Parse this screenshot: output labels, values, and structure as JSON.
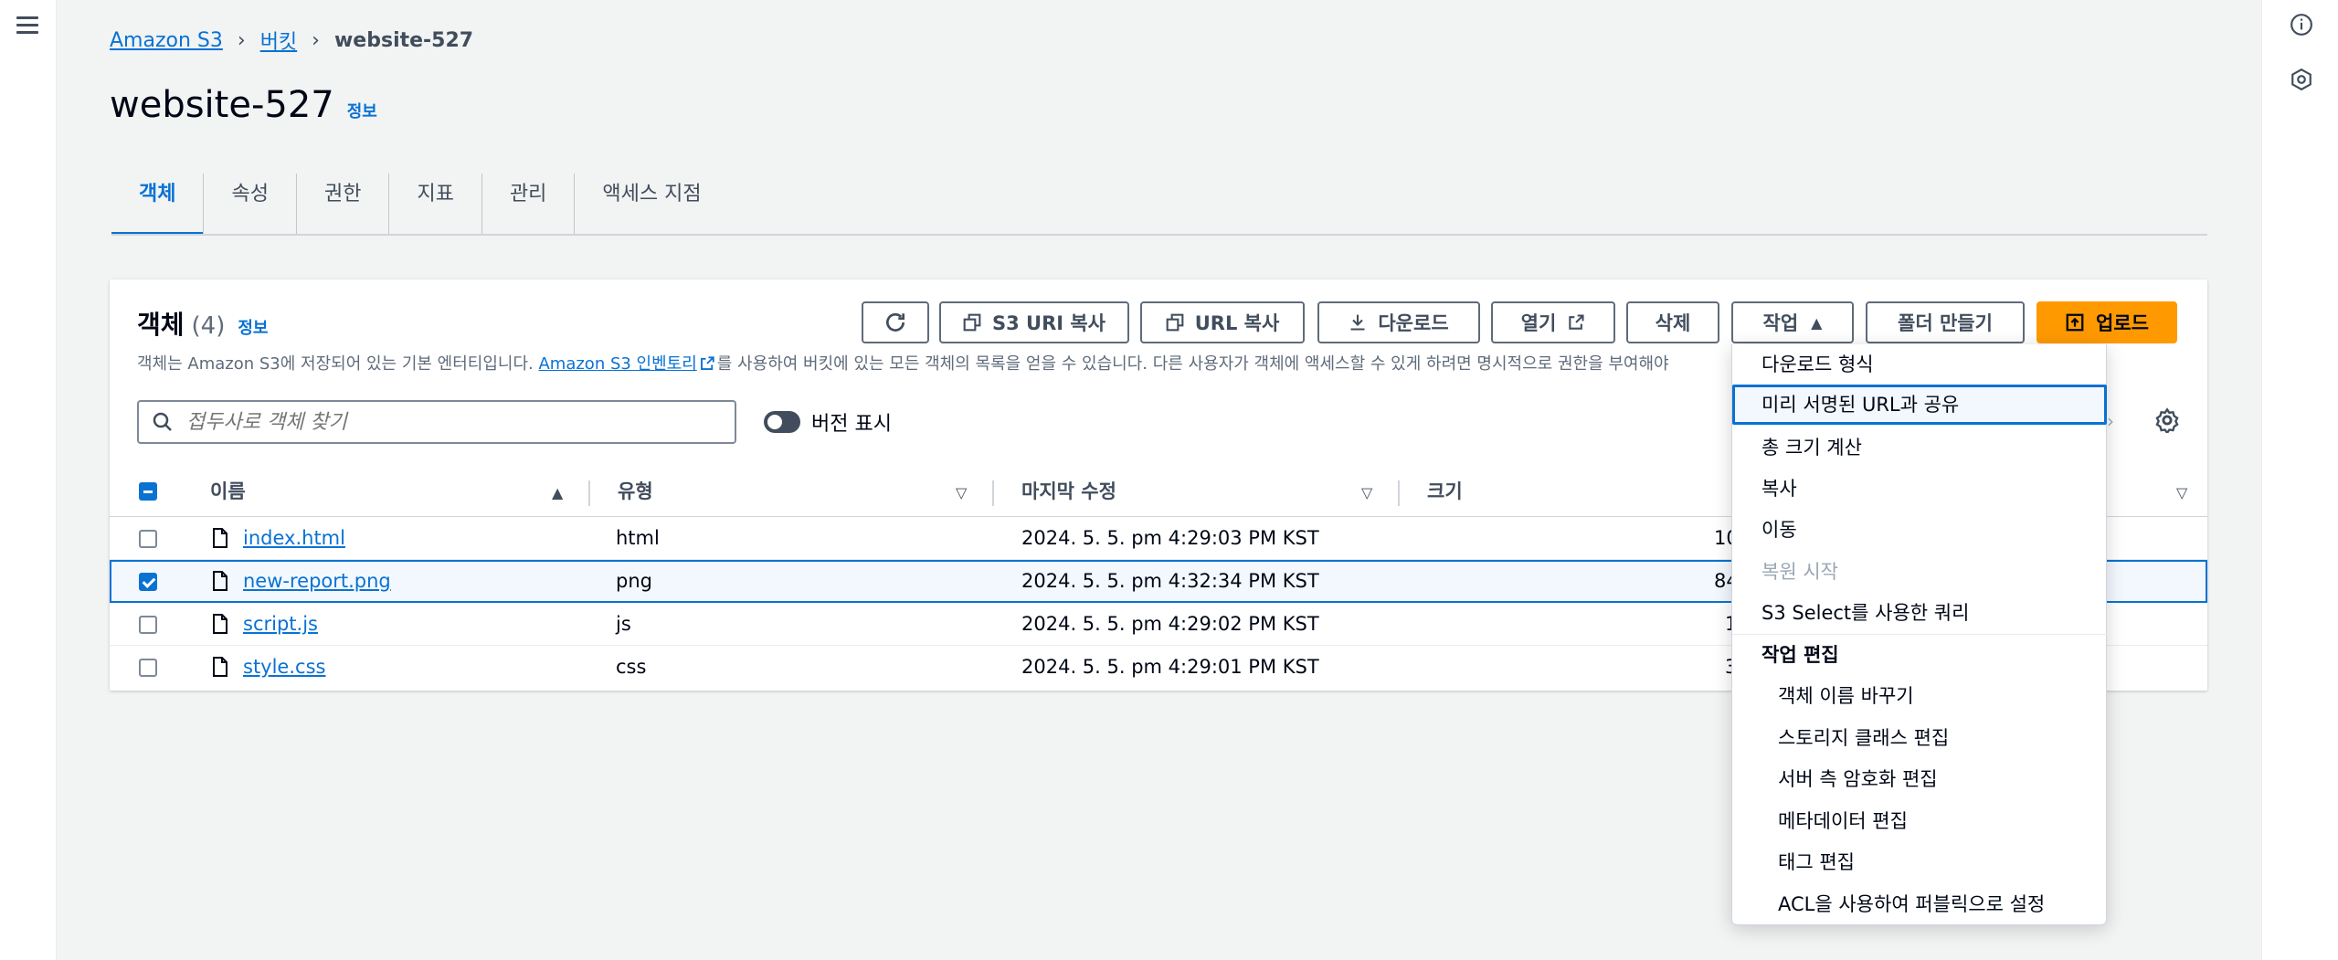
{
  "breadcrumb": {
    "items": [
      "Amazon S3",
      "버킷"
    ],
    "current": "website-527"
  },
  "page": {
    "title": "website-527",
    "info": "정보"
  },
  "tabs": [
    {
      "label": "객체"
    },
    {
      "label": "속성"
    },
    {
      "label": "권한"
    },
    {
      "label": "지표"
    },
    {
      "label": "관리"
    },
    {
      "label": "액세스 지점"
    }
  ],
  "objects": {
    "title": "객체",
    "count": "(4)",
    "info": "정보",
    "desc_prefix": "객체는 Amazon S3에 저장되어 있는 기본 엔터티입니다. ",
    "desc_link": "Amazon S3 인벤토리",
    "desc_suffix": "를 사용하여 버킷에 있는 모든 객체의 목록을 얻을 수 있습니다. 다른 사용자가 객체에 액세스할 수 있게 하려면 명시적으로 권한을 부여해야",
    "search_placeholder": "접두사로 객체 찾기",
    "show_versions": "버전 표시"
  },
  "toolbar": {
    "copy_s3_uri": "S3 URI 복사",
    "copy_url": "URL 복사",
    "download": "다운로드",
    "open": "열기",
    "delete": "삭제",
    "actions": "작업",
    "create_folder": "폴더 만들기",
    "upload": "업로드"
  },
  "table": {
    "columns": [
      "이름",
      "유형",
      "마지막 수정",
      "크기"
    ],
    "rows": [
      {
        "name": "index.html",
        "type": "html",
        "modified": "2024. 5. 5. pm 4:29:03 PM KST",
        "size": "10",
        "checked": false
      },
      {
        "name": "new-report.png",
        "type": "png",
        "modified": "2024. 5. 5. pm 4:32:34 PM KST",
        "size": "84",
        "checked": true
      },
      {
        "name": "script.js",
        "type": "js",
        "modified": "2024. 5. 5. pm 4:29:02 PM KST",
        "size": "1",
        "checked": false
      },
      {
        "name": "style.css",
        "type": "css",
        "modified": "2024. 5. 5. pm 4:29:01 PM KST",
        "size": "3",
        "checked": false
      }
    ]
  },
  "actions_menu": {
    "items": [
      {
        "label": "다운로드 형식"
      },
      {
        "label": "미리 서명된 URL과 공유"
      },
      {
        "label": "총 크기 계산"
      },
      {
        "label": "복사"
      },
      {
        "label": "이동"
      },
      {
        "label": "복원 시작"
      },
      {
        "label": "S3 Select를 사용한 쿼리"
      }
    ],
    "group_label": "작업 편집",
    "group_items": [
      {
        "label": "객체 이름 바꾸기"
      },
      {
        "label": "스토리지 클래스 편집"
      },
      {
        "label": "서버 측 암호화 편집"
      },
      {
        "label": "메타데이터 편집"
      },
      {
        "label": "태그 편집"
      },
      {
        "label": "ACL을 사용하여 퍼블릭으로 설정"
      }
    ]
  },
  "colors": {
    "link": "#0972d3",
    "primary": "#ff9900",
    "text": "#000716"
  }
}
